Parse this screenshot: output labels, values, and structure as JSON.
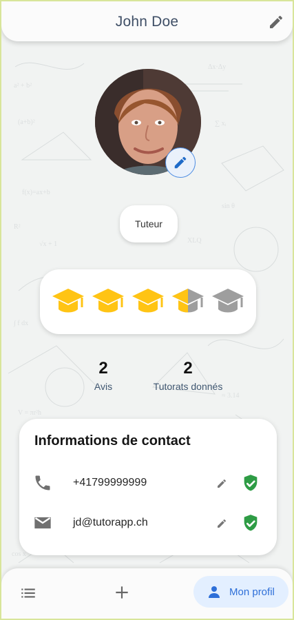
{
  "header": {
    "title": "John Doe",
    "edit_icon": "pencil-icon"
  },
  "profile": {
    "photo_description": "portrait",
    "avatar_edit_icon": "pencil-icon",
    "role": "Tuteur"
  },
  "rating": {
    "max": 5,
    "value": 3.5,
    "filled_color": "#FFC414",
    "empty_color": "#9E9E9E",
    "icon": "graduation-cap-icon"
  },
  "stats": [
    {
      "value": "2",
      "label": "Avis"
    },
    {
      "value": "2",
      "label": "Tutorats donnés"
    }
  ],
  "contact": {
    "title": "Informations de contact",
    "items": [
      {
        "icon": "phone-icon",
        "value": "+41799999999",
        "verified": true
      },
      {
        "icon": "email-icon",
        "value": "jd@tutorapp.ch",
        "verified": true
      }
    ]
  },
  "bottom_nav": {
    "list_icon": "list-icon",
    "add_icon": "add-icon",
    "profile_icon": "person-icon",
    "profile_label": "Mon profil"
  },
  "colors": {
    "accent_blue": "#2E6FD8",
    "verified_green": "#2E9C45",
    "background": "#F1F3F2"
  }
}
